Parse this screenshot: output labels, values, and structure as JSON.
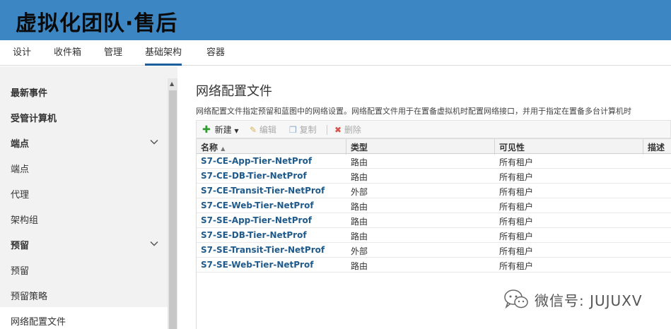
{
  "banner": {
    "title": "虚拟化团队·售后"
  },
  "tabs": [
    {
      "label": "设计"
    },
    {
      "label": "收件箱"
    },
    {
      "label": "管理"
    },
    {
      "label": "基础架构"
    },
    {
      "label": "容器"
    }
  ],
  "active_tab": "基础架构",
  "sidebar": {
    "items": [
      {
        "label": "最新事件"
      },
      {
        "label": "受管计算机"
      },
      {
        "label": "端点"
      },
      {
        "label": "端点"
      },
      {
        "label": "代理"
      },
      {
        "label": "架构组"
      },
      {
        "label": "预留"
      },
      {
        "label": "预留"
      },
      {
        "label": "预留策略"
      },
      {
        "label": "网络配置文件"
      }
    ],
    "selected": "网络配置文件"
  },
  "main": {
    "title": "网络配置文件",
    "description": "网络配置文件指定预留和蓝图中的网络设置。网络配置文件用于在置备虚拟机时配置网络接口，并用于指定在置备多台计算机时"
  },
  "toolbar": {
    "new_label": "新建",
    "edit_label": "编辑",
    "copy_label": "复制",
    "delete_label": "删除"
  },
  "table": {
    "columns": [
      "名称",
      "类型",
      "可见性",
      "描述"
    ],
    "sort_indicator": "▲",
    "rows": [
      {
        "name": "S7-CE-App-Tier-NetProf",
        "type": "路由",
        "visibility": "所有租户"
      },
      {
        "name": "S7-CE-DB-Tier-NetProf",
        "type": "路由",
        "visibility": "所有租户"
      },
      {
        "name": "S7-CE-Transit-Tier-NetProf",
        "type": "外部",
        "visibility": "所有租户"
      },
      {
        "name": "S7-CE-Web-Tier-NetProf",
        "type": "路由",
        "visibility": "所有租户"
      },
      {
        "name": "S7-SE-App-Tier-NetProf",
        "type": "路由",
        "visibility": "所有租户"
      },
      {
        "name": "S7-SE-DB-Tier-NetProf",
        "type": "路由",
        "visibility": "所有租户"
      },
      {
        "name": "S7-SE-Transit-Tier-NetProf",
        "type": "外部",
        "visibility": "所有租户"
      },
      {
        "name": "S7-SE-Web-Tier-NetProf",
        "type": "路由",
        "visibility": "所有租户"
      }
    ]
  },
  "watermark": {
    "text": "微信号: JUJUXV"
  },
  "colors": {
    "banner": "#3c87c3",
    "link": "#1f5a8c",
    "add_icon": "#2e9b2e",
    "delete_icon": "#d9534f"
  }
}
